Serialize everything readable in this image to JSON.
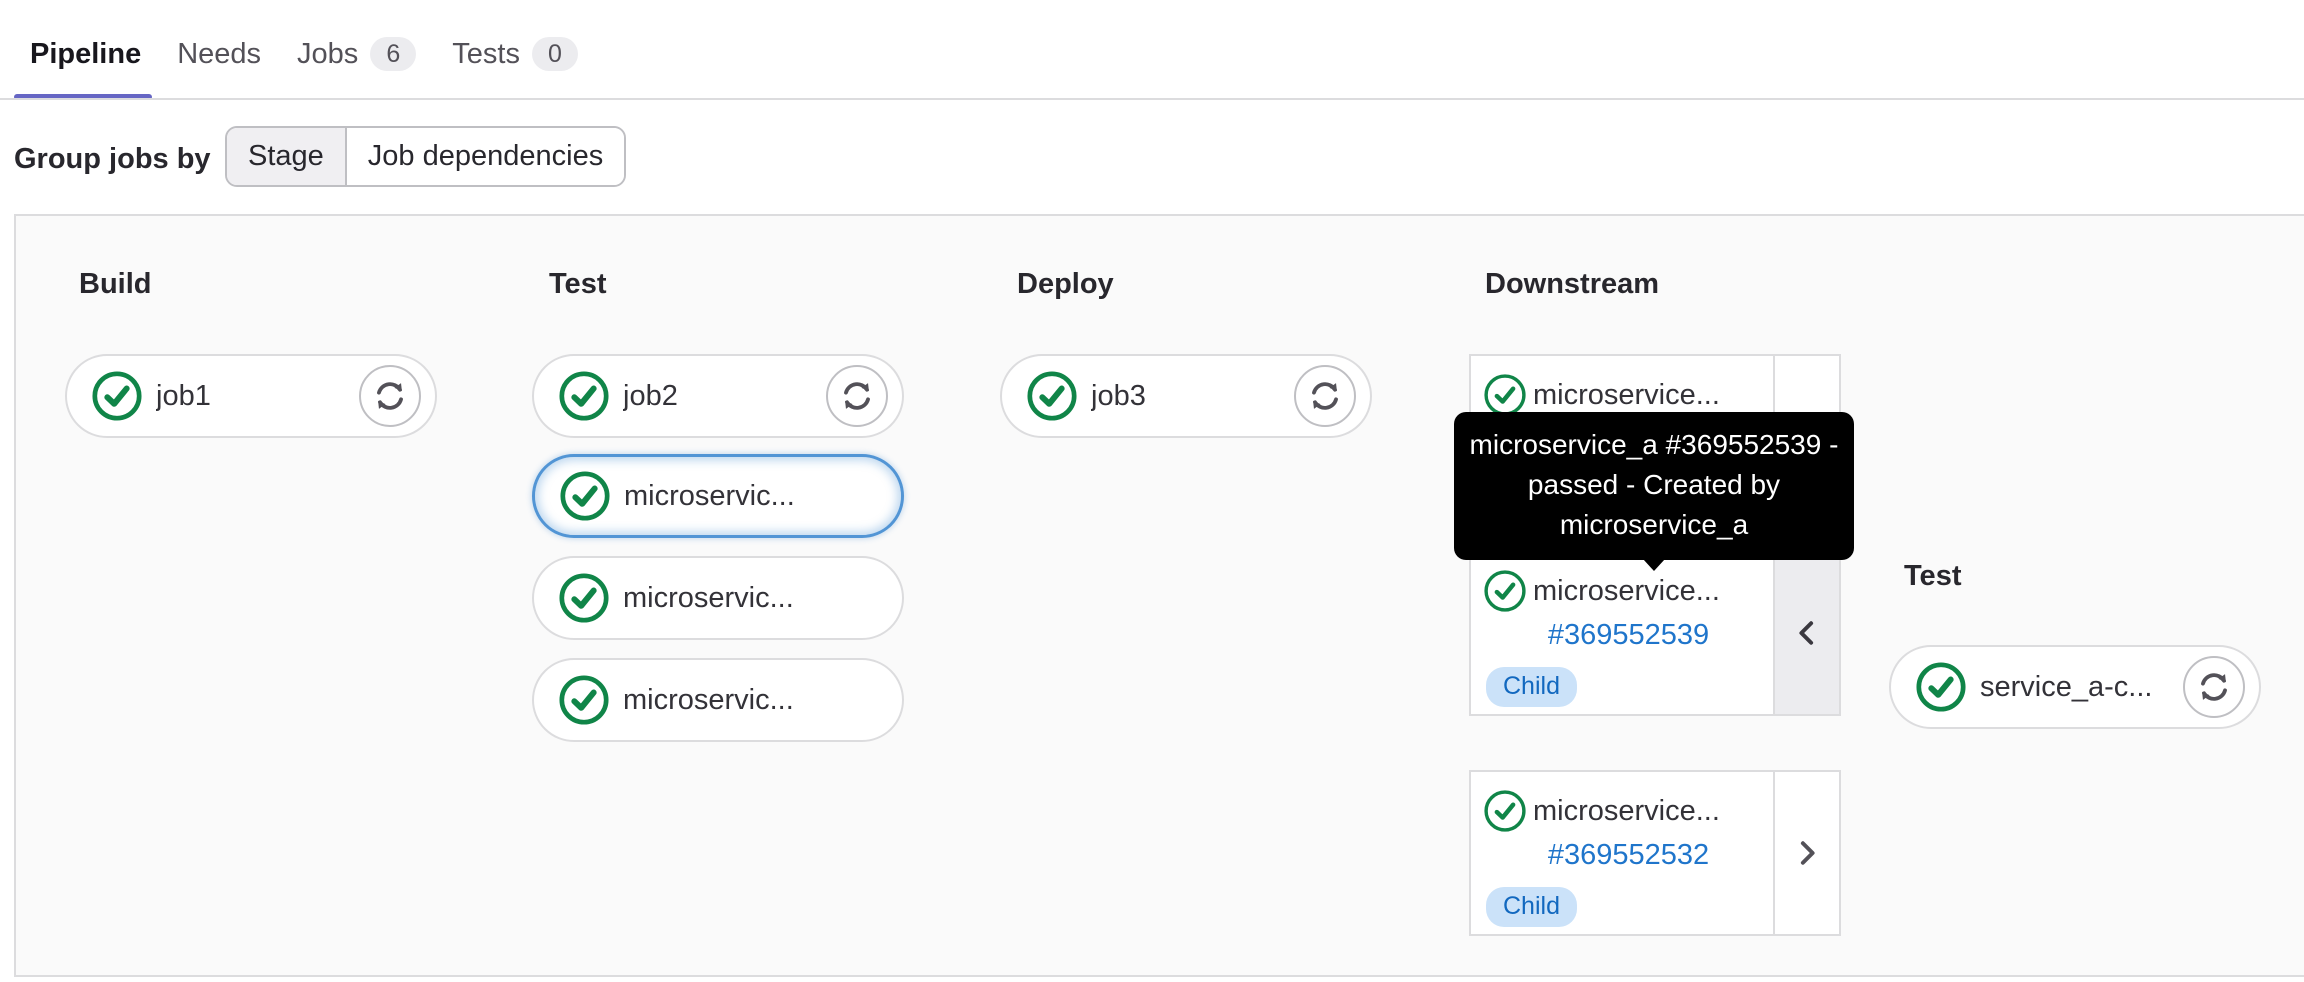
{
  "tabs": [
    {
      "label": "Pipeline",
      "active": true
    },
    {
      "label": "Needs",
      "active": false
    },
    {
      "label": "Jobs",
      "count": "6",
      "active": false
    },
    {
      "label": "Tests",
      "count": "0",
      "active": false
    }
  ],
  "toolbar": {
    "group_label": "Group jobs by",
    "options": [
      {
        "label": "Stage",
        "selected": true
      },
      {
        "label": "Job dependencies",
        "selected": false
      }
    ]
  },
  "pipeline": {
    "stages": [
      {
        "name": "Build",
        "jobs": [
          {
            "label": "job1",
            "status": "passed",
            "action": "retry"
          }
        ]
      },
      {
        "name": "Test",
        "jobs": [
          {
            "label": "job2",
            "status": "passed",
            "action": "retry"
          },
          {
            "label": "microservic...",
            "status": "passed",
            "highlighted": true
          },
          {
            "label": "microservic...",
            "status": "passed"
          },
          {
            "label": "microservic...",
            "status": "passed"
          }
        ]
      },
      {
        "name": "Deploy",
        "jobs": [
          {
            "label": "job3",
            "status": "passed",
            "action": "retry"
          }
        ]
      }
    ],
    "downstream": {
      "name": "Downstream",
      "cards": [
        {
          "label": "microservice...",
          "status": "passed"
        },
        {
          "label": "microservice...",
          "pipeline_link": "#369552539",
          "badge": "Child",
          "status": "passed",
          "expanded": true
        },
        {
          "label": "microservice...",
          "pipeline_link": "#369552532",
          "badge": "Child",
          "status": "passed"
        }
      ]
    },
    "child_pipeline": {
      "stage_name": "Test",
      "jobs": [
        {
          "label": "service_a-c...",
          "status": "passed",
          "action": "retry"
        }
      ]
    }
  },
  "tooltip": {
    "text": "microservice_a #369552539 - passed - Created by microservice_a",
    "lines": [
      "microservice_a #369552539 -",
      "passed - Created by",
      "microservice_a"
    ]
  },
  "colors": {
    "accent_purple": "#6666c4",
    "success_green": "#108548",
    "link_blue": "#1f75cb",
    "badge_info_bg": "#cbe2f9",
    "badge_info_text": "#1268bf",
    "tooltip_bg": "#000000",
    "focus_ring": "#5295d5"
  }
}
